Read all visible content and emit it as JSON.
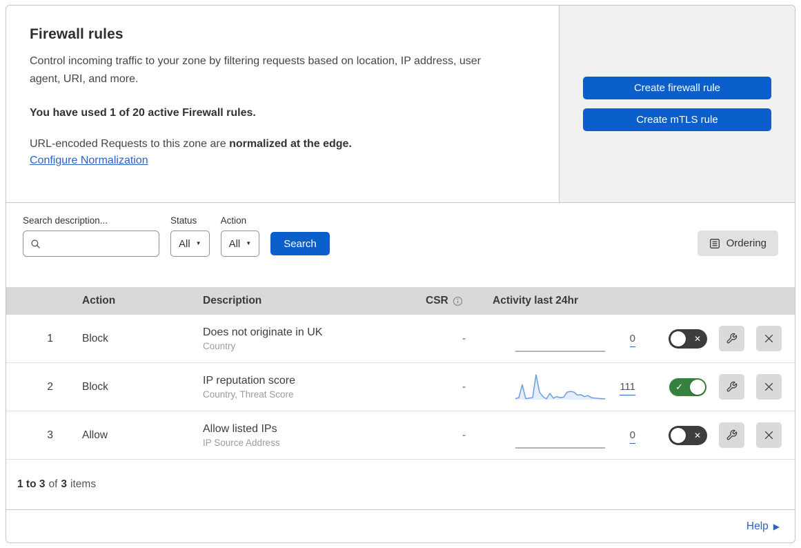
{
  "colors": {
    "primary_button": "#0b5fcb",
    "link": "#2a62c4",
    "toggle_on": "#36813f",
    "toggle_off": "#3d3d3d",
    "sparkline_line": "#6d9be0",
    "sparkline_fill": "rgba(109,155,224,0.18)",
    "sparkline_flat": "#9a9a9a",
    "table_header_bg": "#d9d9d9"
  },
  "header": {
    "title": "Firewall rules",
    "description": "Control incoming traffic to your zone by filtering requests based on location, IP address, user agent, URI, and more.",
    "usage_note": "You have used 1 of 20 active Firewall rules.",
    "normalization_text": "URL-encoded Requests to this zone are ",
    "normalization_bold": "normalized at the edge.",
    "normalization_link": "Configure Normalization",
    "create_firewall_rule_button": "Create firewall rule",
    "create_mtls_rule_button": "Create mTLS rule"
  },
  "filters": {
    "search_label": "Search description...",
    "search_value": "",
    "status_label": "Status",
    "status_value": "All",
    "action_label": "Action",
    "action_value": "All",
    "search_button": "Search",
    "ordering_button": "Ordering"
  },
  "table": {
    "columns": {
      "action": "Action",
      "description": "Description",
      "csr": "CSR",
      "activity": "Activity last 24hr"
    },
    "rows": [
      {
        "priority": "1",
        "action": "Block",
        "description": "Does not originate in UK",
        "criteria": "Country",
        "csr": "-",
        "activity_count": "0",
        "enabled": false,
        "sparkline": []
      },
      {
        "priority": "2",
        "action": "Block",
        "description": "IP reputation score",
        "criteria": "Country, Threat Score",
        "csr": "-",
        "activity_count": "111",
        "enabled": true,
        "sparkline": [
          4,
          8,
          60,
          4,
          6,
          8,
          100,
          30,
          12,
          3,
          25,
          6,
          12,
          8,
          10,
          30,
          33,
          30,
          18,
          20,
          12,
          16,
          8,
          6,
          5,
          4,
          3
        ]
      },
      {
        "priority": "3",
        "action": "Allow",
        "description": "Allow listed IPs",
        "criteria": "IP Source Address",
        "csr": "-",
        "activity_count": "0",
        "enabled": false,
        "sparkline": []
      }
    ]
  },
  "footer": {
    "range": "1 to 3",
    "of_label": "of",
    "total": "3",
    "items_label": "items"
  },
  "help": {
    "label": "Help"
  }
}
